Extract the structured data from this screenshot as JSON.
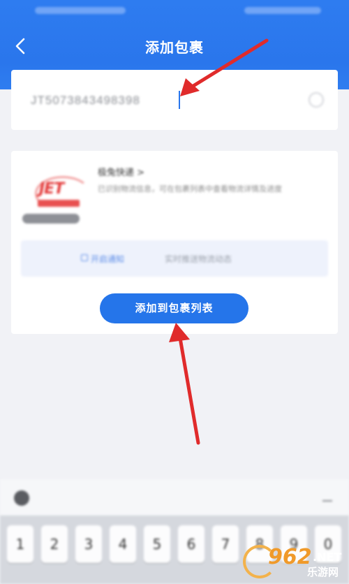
{
  "header": {
    "title": "添加包裹"
  },
  "tracking": {
    "value": "JT5073843498398"
  },
  "courier": {
    "name": "极兔快递 >",
    "description": "已识别物流信息，可在包裹列表中查看物流详情及进度"
  },
  "notify": {
    "toggle_label": "开启通知",
    "description": "实时推送物流动态"
  },
  "add_button": {
    "label": "添加到包裹列表"
  },
  "keyboard": {
    "keys": [
      "1",
      "2",
      "3",
      "4",
      "5",
      "6",
      "7",
      "8",
      "9",
      "0"
    ]
  },
  "watermark": {
    "number": "962",
    "suffix": ".NET",
    "site_name": "乐游网"
  },
  "colors": {
    "brand_blue": "#2a76ec",
    "arrow_red": "#e02b2b"
  }
}
